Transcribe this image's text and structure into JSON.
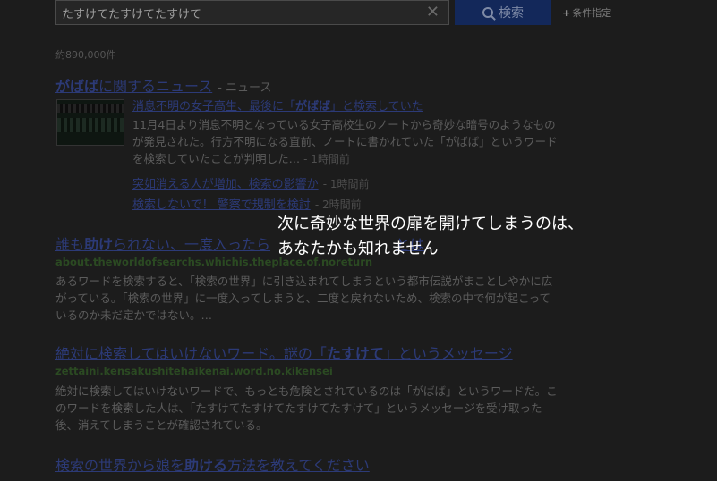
{
  "search": {
    "query": "たすけてたすけてたすけて",
    "button_label": "検索",
    "conditions_label": "条件指定"
  },
  "result_count": "約890,000件",
  "news": {
    "title_keyword": "がばば",
    "title_suffix": "に関するニュース",
    "title_tag": "- ニュース",
    "main_link_pre": "消息不明の女子高生、最後に「",
    "main_link_kw": "がばば",
    "main_link_post": "」と検索していた",
    "snippet": "11月4日より消息不明となっている女子高校生のノートから奇妙な暗号のようなものが発見された。行方不明になる直前、ノートに書かれていた「がばば」というワードを検索していたことが判明した…",
    "snippet_time": "- 1時間前",
    "sub_links": [
      {
        "text": "突如消える人が増加、検索の影響か",
        "time": "- 1時間前"
      },
      {
        "text": "検索しないで！ 警察で規制を検討",
        "time": "- 2時間前"
      }
    ]
  },
  "results": [
    {
      "title_pre": "誰も",
      "title_kw": "助け",
      "title_post": "られない、一度入ったら",
      "title_tail": "とは",
      "url": "about.theworldofsearchs.whichis.theplace.of.noreturn",
      "snippet": "あるワードを検索すると、「検索の世界」に引き込まれてしまうという都市伝説がまことしやかに広がっている。「検索の世界」に一度入ってしまうと、二度と戻れないため、検索の中で何が起こっているのか未だ定かではない。…"
    },
    {
      "title_pre": "絶対に検索してはいけないワード。謎の「",
      "title_kw": "たすけて",
      "title_post": "」というメッセージ",
      "url": "zettaini.kensakushitehaikenai.word.no.kikensei",
      "snippet": "絶対に検索してはいけないワードで、もっとも危険とされているのは「がばば」というワードだ。このワードを検索した人は、「たすけてたすけてたすけてたすけて」というメッセージを受け取った後、消えてしまうことが確認されている。"
    },
    {
      "title_pre": "検索の世界から娘を",
      "title_kw": "助ける",
      "title_post": "方法を教えてください"
    }
  ],
  "overlay": {
    "line1": "次に奇妙な世界の扉を開けてしまうのは、",
    "line2": "あなたかも知れません"
  }
}
